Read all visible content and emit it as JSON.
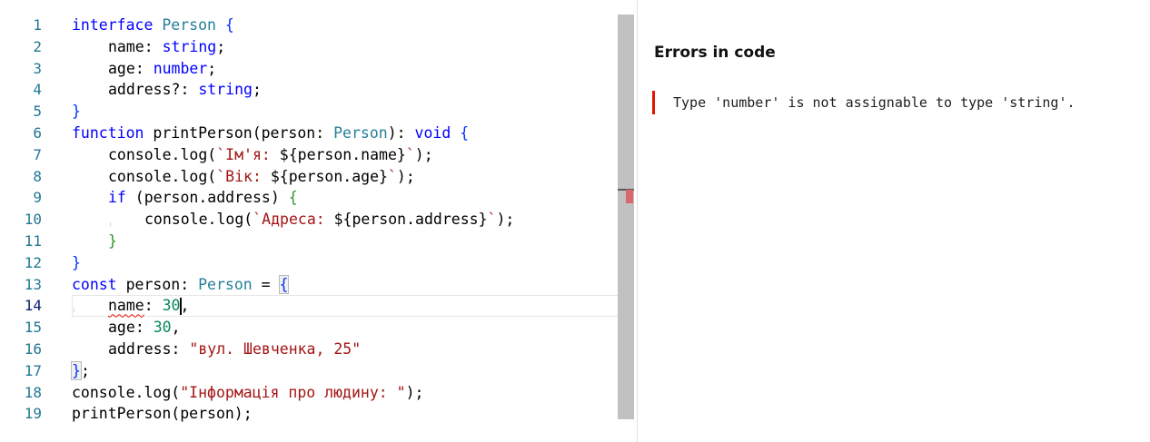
{
  "editor": {
    "line_numbers": [
      "1",
      "2",
      "3",
      "4",
      "5",
      "6",
      "7",
      "8",
      "9",
      "10",
      "11",
      "12",
      "13",
      "14",
      "15",
      "16",
      "17",
      "18",
      "19"
    ],
    "active_line": "14",
    "lines": {
      "l1": {
        "t1": "interface",
        "t2": " ",
        "t3": "Person",
        "t4": " {"
      },
      "l2": {
        "t1": "name",
        "t2": ": ",
        "t3": "string",
        "t4": ";"
      },
      "l3": {
        "t1": "age",
        "t2": ": ",
        "t3": "number",
        "t4": ";"
      },
      "l4": {
        "t1": "address?",
        "t2": ": ",
        "t3": "string",
        "t4": ";"
      },
      "l5": {
        "t1": "}"
      },
      "l6": {
        "t1": "function",
        "t2": " printPerson(person: ",
        "t3": "Person",
        "t4": "): ",
        "t5": "void",
        "t6": " {"
      },
      "l7": {
        "t1": "console.log(",
        "t2": "`Ім'я: ",
        "t3": "${person.name}",
        "t4": "`",
        "t5": ");"
      },
      "l8": {
        "t1": "console.log(",
        "t2": "`Вік: ",
        "t3": "${person.age}",
        "t4": "`",
        "t5": ");"
      },
      "l9": {
        "t1": "if",
        "t2": " (person.address) ",
        "t3": "{"
      },
      "l10": {
        "t1": "console.log(",
        "t2": "`Адреса: ",
        "t3": "${person.address}",
        "t4": "`",
        "t5": ");"
      },
      "l11": {
        "t1": "}"
      },
      "l12": {
        "t1": "}"
      },
      "l13": {
        "t1": "const",
        "t2": " person: ",
        "t3": "Person",
        "t4": " = ",
        "t5": "{"
      },
      "l14": {
        "t1": "name",
        "t2": ": ",
        "t3": "30",
        "t4": ","
      },
      "l15": {
        "t1": "age",
        "t2": ": ",
        "t3": "30",
        "t4": ","
      },
      "l16": {
        "t1": "address",
        "t2": ": ",
        "t3": "\"вул. Шевченка, 25\""
      },
      "l17": {
        "t1": "}",
        "t2": ";"
      },
      "l18": {
        "t1": "console.log(",
        "t2": "\"Інформація про людину: \"",
        "t3": ");"
      },
      "l19": {
        "t1": "printPerson(person);"
      }
    }
  },
  "errors_panel": {
    "title": "Errors in code",
    "items": [
      {
        "message": "Type 'number' is not assignable to type 'string'."
      }
    ]
  },
  "colors": {
    "keyword": "#0000ff",
    "type": "#267f99",
    "string": "#a31515",
    "number": "#098658",
    "error": "#e51400",
    "line_number": "#237893"
  }
}
